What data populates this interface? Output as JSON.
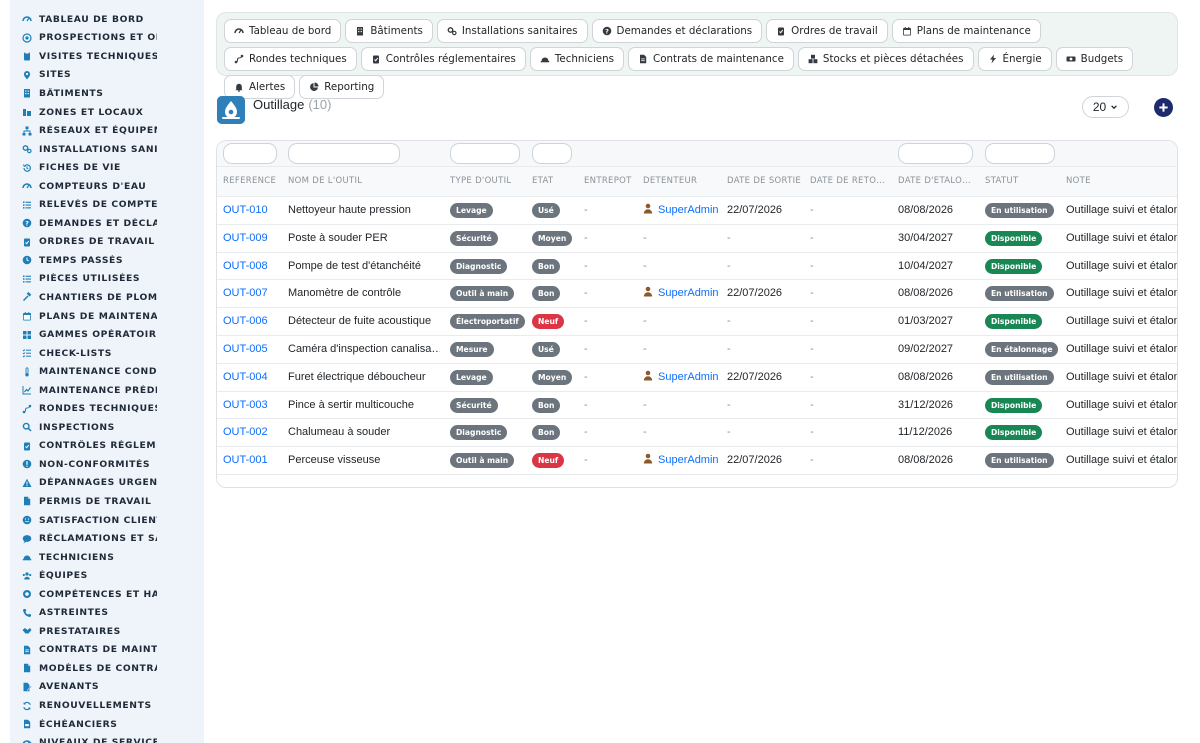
{
  "sidebar": {
    "items": [
      {
        "label": "TABLEAU DE BORD",
        "icon": "gauge-icon"
      },
      {
        "label": "PROSPECTIONS ET OPPORTUNITÉS",
        "icon": "target-icon"
      },
      {
        "label": "VISITES TECHNIQUES ET DEVIS",
        "icon": "clipboard-icon"
      },
      {
        "label": "SITES",
        "icon": "map-pin-icon"
      },
      {
        "label": "BÂTIMENTS",
        "icon": "building-icon"
      },
      {
        "label": "ZONES ET LOCAUX",
        "icon": "zones-icon"
      },
      {
        "label": "RÉSEAUX ET ÉQUIPEMENTS",
        "icon": "network-icon"
      },
      {
        "label": "INSTALLATIONS SANITAIRES",
        "icon": "cogs-icon"
      },
      {
        "label": "FICHES DE VIE",
        "icon": "history-icon"
      },
      {
        "label": "COMPTEURS D'EAU",
        "icon": "gauge-icon"
      },
      {
        "label": "RELEVÉS DE COMPTEURS",
        "icon": "list-icon"
      },
      {
        "label": "DEMANDES ET DÉCLARATIONS",
        "icon": "question-circle-icon"
      },
      {
        "label": "ORDRES DE TRAVAIL",
        "icon": "clipboard-check-icon"
      },
      {
        "label": "TEMPS PASSÉS",
        "icon": "clock-icon"
      },
      {
        "label": "PIÈCES UTILISÉES",
        "icon": "list-icon"
      },
      {
        "label": "CHANTIERS DE PLOMBERIE",
        "icon": "hammer-icon"
      },
      {
        "label": "PLANS DE MAINTENANCE",
        "icon": "calendar-icon"
      },
      {
        "label": "GAMMES OPÉRATOIRES",
        "icon": "grid-icon"
      },
      {
        "label": "CHECK-LISTS",
        "icon": "checklist-icon"
      },
      {
        "label": "MAINTENANCE CONDITIONNELLE",
        "icon": "thermometer-icon"
      },
      {
        "label": "MAINTENANCE PRÉDICTIVE",
        "icon": "chart-icon"
      },
      {
        "label": "RONDES TECHNIQUES",
        "icon": "route-icon"
      },
      {
        "label": "INSPECTIONS",
        "icon": "search-icon"
      },
      {
        "label": "CONTRÔLES RÉGLEMENTAIRES",
        "icon": "clipboard-check-icon"
      },
      {
        "label": "NON-CONFORMITÉS",
        "icon": "alert-circle-icon"
      },
      {
        "label": "DÉPANNAGES URGENTS",
        "icon": "warning-icon"
      },
      {
        "label": "PERMIS DE TRAVAIL",
        "icon": "file-icon"
      },
      {
        "label": "SATISFACTION CLIENT",
        "icon": "smile-icon"
      },
      {
        "label": "RÉCLAMATIONS ET SAV",
        "icon": "comment-icon"
      },
      {
        "label": "TECHNICIENS",
        "icon": "hard-hat-icon"
      },
      {
        "label": "ÉQUIPES",
        "icon": "users-icon"
      },
      {
        "label": "COMPÉTENCES ET HABILITATIONS",
        "icon": "certificate-icon"
      },
      {
        "label": "ASTREINTES",
        "icon": "phone-icon"
      },
      {
        "label": "PRESTATAIRES",
        "icon": "handshake-icon"
      },
      {
        "label": "CONTRATS DE MAINTENANCE",
        "icon": "file-contract-icon"
      },
      {
        "label": "MODÈLES DE CONTRATS",
        "icon": "file-icon"
      },
      {
        "label": "AVENANTS",
        "icon": "file-edit-icon"
      },
      {
        "label": "RENOUVELLEMENTS",
        "icon": "refresh-icon"
      },
      {
        "label": "ÉCHÉANCIERS",
        "icon": "file-invoice-icon"
      },
      {
        "label": "NIVEAUX DE SERVICE (SLA)",
        "icon": "gauge-icon"
      }
    ]
  },
  "topnav": {
    "items": [
      {
        "label": "Tableau de bord",
        "icon": "gauge-icon"
      },
      {
        "label": "Bâtiments",
        "icon": "building-icon"
      },
      {
        "label": "Installations sanitaires",
        "icon": "cogs-icon"
      },
      {
        "label": "Demandes et déclarations",
        "icon": "question-circle-icon"
      },
      {
        "label": "Ordres de travail",
        "icon": "clipboard-check-icon"
      },
      {
        "label": "Plans de maintenance",
        "icon": "calendar-icon"
      },
      {
        "label": "Rondes techniques",
        "icon": "route-icon"
      },
      {
        "label": "Contrôles réglementaires",
        "icon": "clipboard-check-icon"
      },
      {
        "label": "Techniciens",
        "icon": "hard-hat-icon"
      },
      {
        "label": "Contrats de maintenance",
        "icon": "file-contract-icon"
      },
      {
        "label": "Stocks et pièces détachées",
        "icon": "boxes-icon"
      },
      {
        "label": "Énergie",
        "icon": "bolt-icon"
      },
      {
        "label": "Budgets",
        "icon": "money-icon"
      },
      {
        "label": "Alertes",
        "icon": "bell-icon"
      },
      {
        "label": "Reporting",
        "icon": "pie-chart-icon"
      }
    ]
  },
  "header": {
    "title": "Outillage",
    "count": "(10)",
    "page_size": "20"
  },
  "table": {
    "columns": [
      "RÉFÉRENCE",
      "NOM DE L'OUTIL",
      "TYPE D'OUTIL",
      "ÉTAT",
      "ENTREPÔT",
      "DÉTENTEUR",
      "DATE DE SORTIE",
      "DATE DE RETO…",
      "DATE D'ÉTALO…",
      "STATUT",
      "NOTE"
    ],
    "rows": [
      {
        "ref": "OUT-010",
        "name": "Nettoyeur haute pression",
        "type": "Levage",
        "state": "Usé",
        "state_color": "gray",
        "warehouse": "-",
        "holder": "SuperAdmin",
        "out_date": "22/07/2026",
        "return_date": "-",
        "calib_date": "08/08/2026",
        "status": "En utilisation",
        "status_color": "gray",
        "note": "Outillage suivi et étalonné"
      },
      {
        "ref": "OUT-009",
        "name": "Poste à souder PER",
        "type": "Sécurité",
        "state": "Moyen",
        "state_color": "gray",
        "warehouse": "-",
        "holder": "-",
        "out_date": "-",
        "return_date": "-",
        "calib_date": "30/04/2027",
        "status": "Disponible",
        "status_color": "green",
        "note": "Outillage suivi et étalonné"
      },
      {
        "ref": "OUT-008",
        "name": "Pompe de test d'étanchéité",
        "type": "Diagnostic",
        "state": "Bon",
        "state_color": "gray",
        "warehouse": "-",
        "holder": "-",
        "out_date": "-",
        "return_date": "-",
        "calib_date": "10/04/2027",
        "status": "Disponible",
        "status_color": "green",
        "note": "Outillage suivi et étalonné"
      },
      {
        "ref": "OUT-007",
        "name": "Manomètre de contrôle",
        "type": "Outil à main",
        "state": "Bon",
        "state_color": "gray",
        "warehouse": "-",
        "holder": "SuperAdmin",
        "out_date": "22/07/2026",
        "return_date": "-",
        "calib_date": "08/08/2026",
        "status": "En utilisation",
        "status_color": "gray",
        "note": "Outillage suivi et étalonné"
      },
      {
        "ref": "OUT-006",
        "name": "Détecteur de fuite acoustique",
        "type": "Électroportatif",
        "state": "Neuf",
        "state_color": "red",
        "warehouse": "-",
        "holder": "-",
        "out_date": "-",
        "return_date": "-",
        "calib_date": "01/03/2027",
        "status": "Disponible",
        "status_color": "green",
        "note": "Outillage suivi et étalonné"
      },
      {
        "ref": "OUT-005",
        "name": "Caméra d'inspection canalisa…",
        "type": "Mesure",
        "state": "Usé",
        "state_color": "gray",
        "warehouse": "-",
        "holder": "-",
        "out_date": "-",
        "return_date": "-",
        "calib_date": "09/02/2027",
        "status": "En étalonnage",
        "status_color": "gray",
        "note": "Outillage suivi et étalonné"
      },
      {
        "ref": "OUT-004",
        "name": "Furet électrique déboucheur",
        "type": "Levage",
        "state": "Moyen",
        "state_color": "gray",
        "warehouse": "-",
        "holder": "SuperAdmin",
        "out_date": "22/07/2026",
        "return_date": "-",
        "calib_date": "08/08/2026",
        "status": "En utilisation",
        "status_color": "gray",
        "note": "Outillage suivi et étalonné"
      },
      {
        "ref": "OUT-003",
        "name": "Pince à sertir multicouche",
        "type": "Sécurité",
        "state": "Bon",
        "state_color": "gray",
        "warehouse": "-",
        "holder": "-",
        "out_date": "-",
        "return_date": "-",
        "calib_date": "31/12/2026",
        "status": "Disponible",
        "status_color": "green",
        "note": "Outillage suivi et étalonné"
      },
      {
        "ref": "OUT-002",
        "name": "Chalumeau à souder",
        "type": "Diagnostic",
        "state": "Bon",
        "state_color": "gray",
        "warehouse": "-",
        "holder": "-",
        "out_date": "-",
        "return_date": "-",
        "calib_date": "11/12/2026",
        "status": "Disponible",
        "status_color": "green",
        "note": "Outillage suivi et étalonné"
      },
      {
        "ref": "OUT-001",
        "name": "Perceuse visseuse",
        "type": "Outil à main",
        "state": "Neuf",
        "state_color": "red",
        "warehouse": "-",
        "holder": "SuperAdmin",
        "out_date": "22/07/2026",
        "return_date": "-",
        "calib_date": "08/08/2026",
        "status": "En utilisation",
        "status_color": "gray",
        "note": "Outillage suivi et étalonné"
      }
    ]
  },
  "colors": {
    "accent": "#0d6efd",
    "badge_gray": "#6c757d",
    "badge_green": "#198754",
    "badge_red": "#dc3545",
    "add_button": "#1e2a6e",
    "sidebar_icon": "#1e7fb8"
  }
}
